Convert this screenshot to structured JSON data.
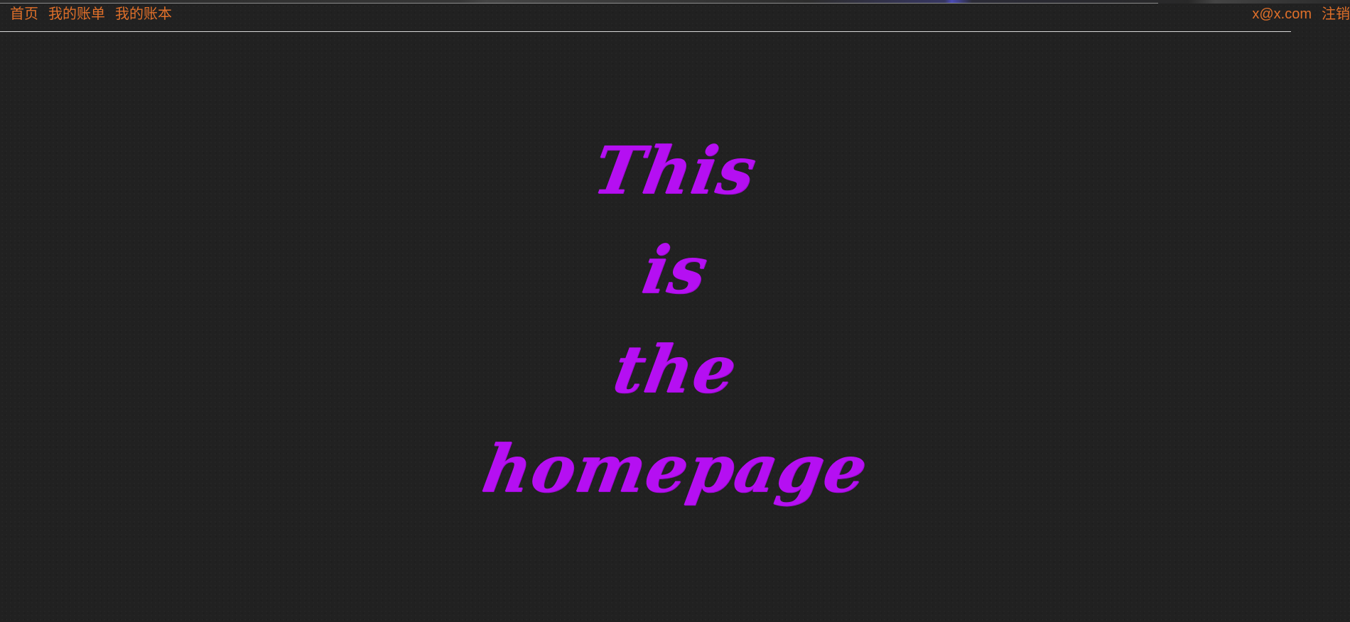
{
  "nav": {
    "left": [
      {
        "label": "首页"
      },
      {
        "label": "我的账单"
      },
      {
        "label": "我的账本"
      }
    ],
    "user_email": "x@x.com",
    "logout_label": "注销"
  },
  "hero": {
    "words": [
      "This",
      "is",
      "the",
      "homepage"
    ]
  },
  "colors": {
    "background": "#212121",
    "nav_link": "#e0702a",
    "hero_text": "#b50ff2",
    "divider": "#d8d8d8"
  }
}
